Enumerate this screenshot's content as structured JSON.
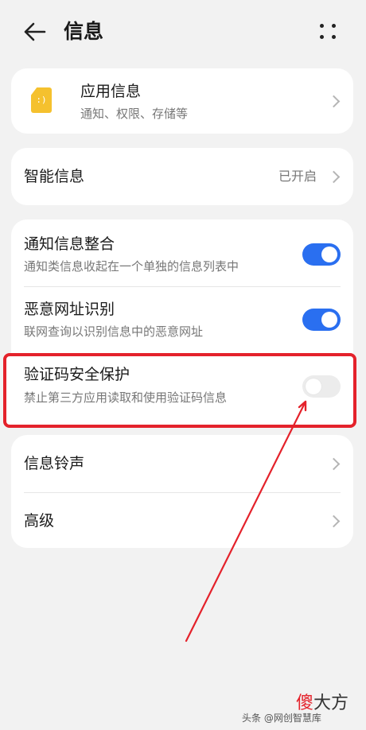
{
  "header": {
    "title": "信息"
  },
  "app_info": {
    "title": "应用信息",
    "subtitle": "通知、权限、存储等",
    "icon_glyph": ":)"
  },
  "smart_info": {
    "title": "智能信息",
    "status": "已开启"
  },
  "toggles": [
    {
      "title": "通知信息整合",
      "subtitle": "通知类信息收起在一个单独的信息列表中",
      "state": "on"
    },
    {
      "title": "恶意网址识别",
      "subtitle": "联网查询以识别信息中的恶意网址",
      "state": "on"
    },
    {
      "title": "验证码安全保护",
      "subtitle": "禁止第三方应用读取和使用验证码信息",
      "state": "off"
    }
  ],
  "bottom_items": [
    {
      "title": "信息铃声"
    },
    {
      "title": "高级"
    }
  ],
  "watermark": {
    "logo_red": "傻",
    "logo_rest": "大方",
    "byline": "头条 @网创智慧库"
  },
  "colors": {
    "accent": "#2a6ff0",
    "highlight": "#e4222b",
    "background": "#f2f2f2"
  }
}
